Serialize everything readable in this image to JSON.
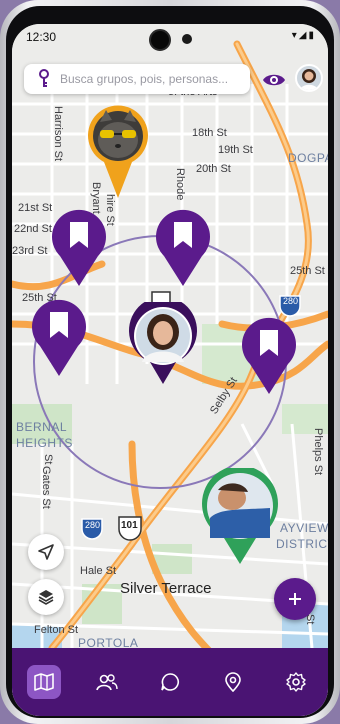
{
  "status_bar": {
    "time": "12:30",
    "icons": [
      "wifi-icon",
      "signal-icon",
      "battery-icon"
    ]
  },
  "search": {
    "placeholder": "Busca grupos, pois, personas..."
  },
  "map": {
    "labels": {
      "arts": "of the Arts",
      "harrison": "Harrison St",
      "st18": "18th St",
      "st19": "19th St",
      "st20": "20th St",
      "dogpatch": "DOGPA",
      "st21": "21st St",
      "st22": "22nd St",
      "st23": "23rd St",
      "st25a": "25th St",
      "st25b": "25th St",
      "bryant": "Bryant",
      "shire": "hire St",
      "rhode": "Rhode",
      "i280a": "280",
      "bernal1": "BERNAL",
      "bernal2": "HEIGHTS",
      "selby": "Selby St",
      "phelps": "Phelps St",
      "gates": "Gates St",
      "bayview": "AYVIEW",
      "district": "DISTRICT",
      "i280b": "280",
      "us101": "101",
      "hale": "Hale St",
      "silver": "Silver Terrace",
      "felton": "Felton St",
      "portola": "PORTOLA",
      "sat": "St",
      "g16": "St"
    },
    "accent_color": "#5b1b8c",
    "road_color": "#f7a54a",
    "radius_color": "#8a78b8"
  },
  "pins": [
    {
      "name": "pin-user-cat",
      "color": "#f0a21c"
    },
    {
      "name": "pin-bookmark-1",
      "color": "#5b1b8c"
    },
    {
      "name": "pin-bookmark-2",
      "color": "#5b1b8c"
    },
    {
      "name": "pin-bookmark-3",
      "color": "#5b1b8c"
    },
    {
      "name": "pin-bookmark-4",
      "color": "#5b1b8c"
    },
    {
      "name": "pin-current-user",
      "color": "#3a0f5c"
    },
    {
      "name": "pin-user-man",
      "color": "#2fa15a"
    }
  ],
  "nav": [
    {
      "name": "nav-map",
      "icon": "map-icon",
      "active": true
    },
    {
      "name": "nav-people",
      "icon": "people-icon",
      "active": false
    },
    {
      "name": "nav-chat",
      "icon": "chat-icon",
      "active": false
    },
    {
      "name": "nav-places",
      "icon": "location-pin-icon",
      "active": false
    },
    {
      "name": "nav-settings",
      "icon": "gear-icon",
      "active": false
    }
  ]
}
